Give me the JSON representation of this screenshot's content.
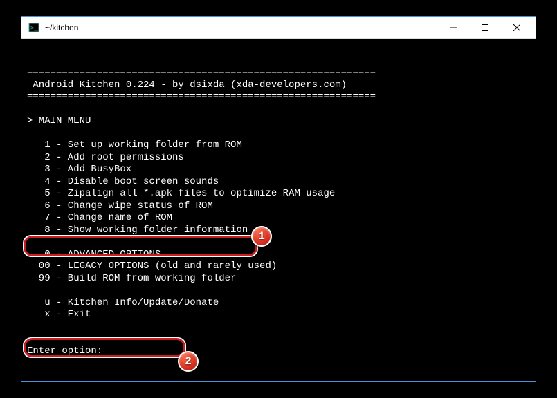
{
  "window": {
    "title": "~/kitchen"
  },
  "terminal": {
    "blank": "",
    "sep1": "============================================================",
    "header": " Android Kitchen 0.224 - by dsixda (xda-developers.com)",
    "sep2": "============================================================",
    "menu_label": "> MAIN MENU",
    "opt1": "   1 - Set up working folder from ROM",
    "opt2": "   2 - Add root permissions",
    "opt3": "   3 - Add BusyBox",
    "opt4": "   4 - Disable boot screen sounds",
    "opt5": "   5 - Zipalign all *.apk files to optimize RAM usage",
    "opt6": "   6 - Change wipe status of ROM",
    "opt7": "   7 - Change name of ROM",
    "opt8": "   8 - Show working folder information",
    "opt0": "   0 - ADVANCED OPTIONS",
    "opt00": "  00 - LEGACY OPTIONS (old and rarely used)",
    "opt99": "  99 - Build ROM from working folder",
    "optu": "   u - Kitchen Info/Update/Donate",
    "optx": "   x - Exit",
    "prompt": "Enter option:"
  },
  "badges": {
    "b1": "1",
    "b2": "2"
  }
}
